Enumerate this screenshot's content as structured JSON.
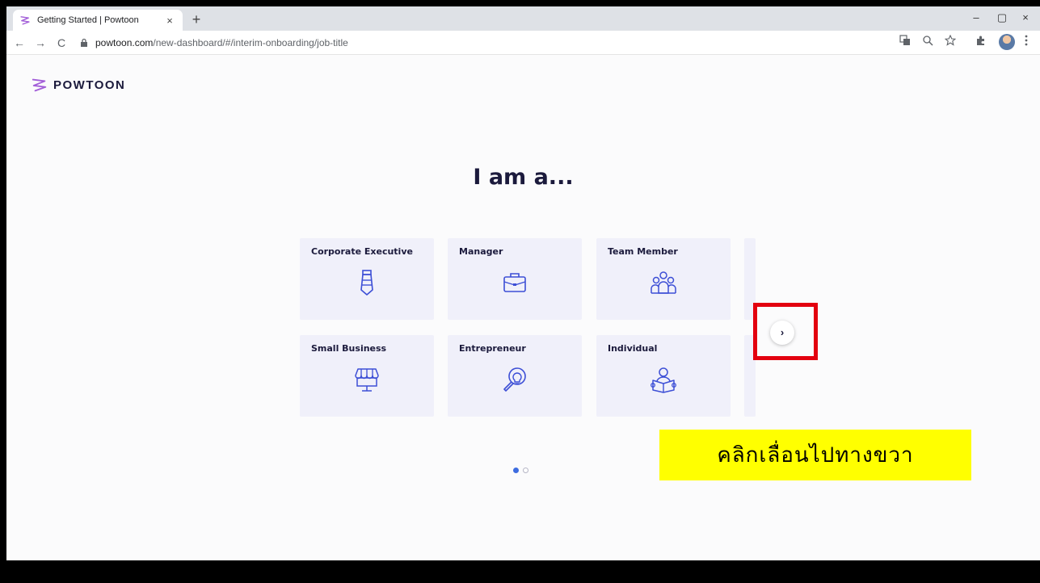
{
  "browser": {
    "tab_title": "Getting Started | Powtoon",
    "tab_close": "×",
    "new_tab": "+",
    "url_host": "powtoon.com",
    "url_path": "/new-dashboard/#/interim-onboarding/job-title",
    "nav_back": "←",
    "nav_forward": "→",
    "nav_reload": "C",
    "win_minimize": "–",
    "win_restore": "▢",
    "win_close": "×"
  },
  "page": {
    "logo_text": "POWTOON",
    "heading": "I am a...",
    "next_label": "›",
    "accent_color": "#3d6ce0",
    "annotation_color": "#ffff00",
    "highlight_color": "#e3000f"
  },
  "cards": [
    {
      "label": "Corporate Executive",
      "icon": "tie-icon"
    },
    {
      "label": "Manager",
      "icon": "briefcase-icon"
    },
    {
      "label": "Team Member",
      "icon": "team-icon"
    },
    {
      "label": "Small Business",
      "icon": "storefront-icon"
    },
    {
      "label": "Entrepreneur",
      "icon": "lightbulb-search-icon"
    },
    {
      "label": "Individual",
      "icon": "person-reading-icon"
    }
  ],
  "pagination": {
    "total": 2,
    "current": 1
  },
  "annotation": {
    "text": "คลิกเลื่อนไปทางขวา"
  }
}
